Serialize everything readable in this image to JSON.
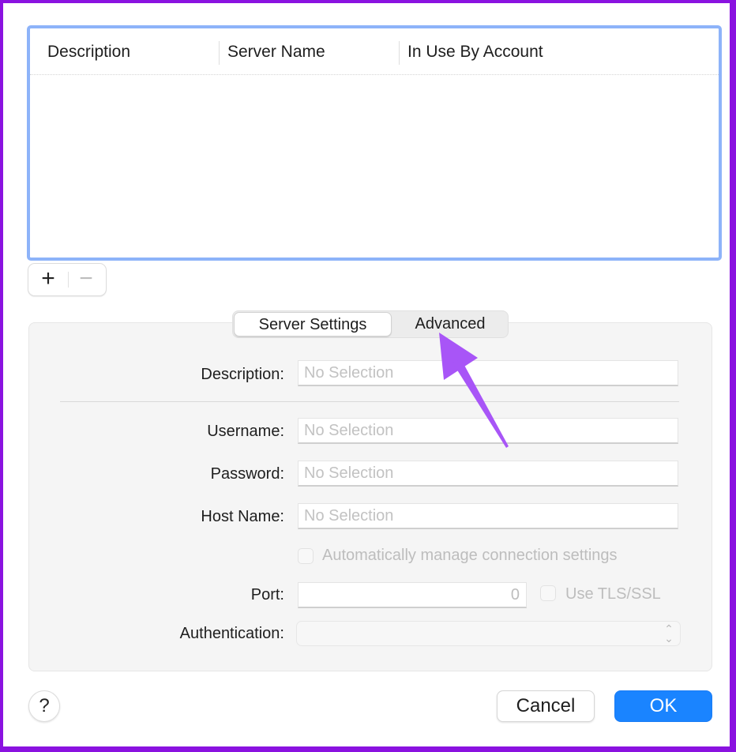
{
  "accounts_table": {
    "columns": [
      "Description",
      "Server Name",
      "In Use By Account"
    ],
    "rows": []
  },
  "list_controls": {
    "add_label": "+",
    "remove_label": "−"
  },
  "tabs": [
    {
      "label": "Server Settings",
      "selected": true
    },
    {
      "label": "Advanced",
      "selected": false
    }
  ],
  "form": {
    "description": {
      "label": "Description:",
      "placeholder": "No Selection",
      "value": ""
    },
    "username": {
      "label": "Username:",
      "placeholder": "No Selection",
      "value": ""
    },
    "password": {
      "label": "Password:",
      "placeholder": "No Selection",
      "value": ""
    },
    "host_name": {
      "label": "Host Name:",
      "placeholder": "No Selection",
      "value": ""
    },
    "auto_manage": {
      "label": "Automatically manage connection settings",
      "checked": false,
      "enabled": false
    },
    "port": {
      "label": "Port:",
      "value": "0"
    },
    "use_tls": {
      "label": "Use TLS/SSL",
      "checked": false,
      "enabled": false
    },
    "authentication": {
      "label": "Authentication:",
      "selected": ""
    }
  },
  "footer": {
    "help_label": "?",
    "cancel_label": "Cancel",
    "ok_label": "OK"
  },
  "annotation": {
    "color": "#a855f7",
    "points_to": "Advanced"
  },
  "colors": {
    "frame": "#8a12e0",
    "table_focus_ring": "#8db3f9",
    "primary_button": "#1a84ff"
  }
}
